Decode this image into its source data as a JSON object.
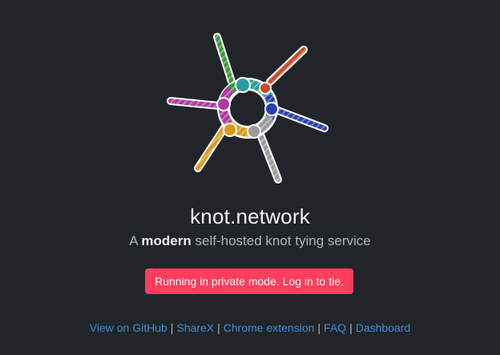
{
  "brand": {
    "logo_icon": "knot-logo-icon",
    "title": "knot.network",
    "tagline_prefix": "A",
    "tagline_emphasis": "modern",
    "tagline_suffix": "self-hosted knot tying service"
  },
  "notice": {
    "text": "Running in private mode. Log in to tie.",
    "color": "#ff3d5c"
  },
  "footer": {
    "links": [
      {
        "label": "View on GitHub"
      },
      {
        "label": "ShareX"
      },
      {
        "label": "Chrome extension"
      },
      {
        "label": "FAQ"
      },
      {
        "label": "Dashboard"
      }
    ],
    "separator": "|",
    "link_color": "#3d8bd8"
  },
  "colors": {
    "background": "#212529",
    "rope_colors": [
      "#3a9a3a",
      "#c94a2a",
      "#2a3fb0",
      "#9a9a9a",
      "#d99a1a",
      "#b03aa0"
    ]
  }
}
